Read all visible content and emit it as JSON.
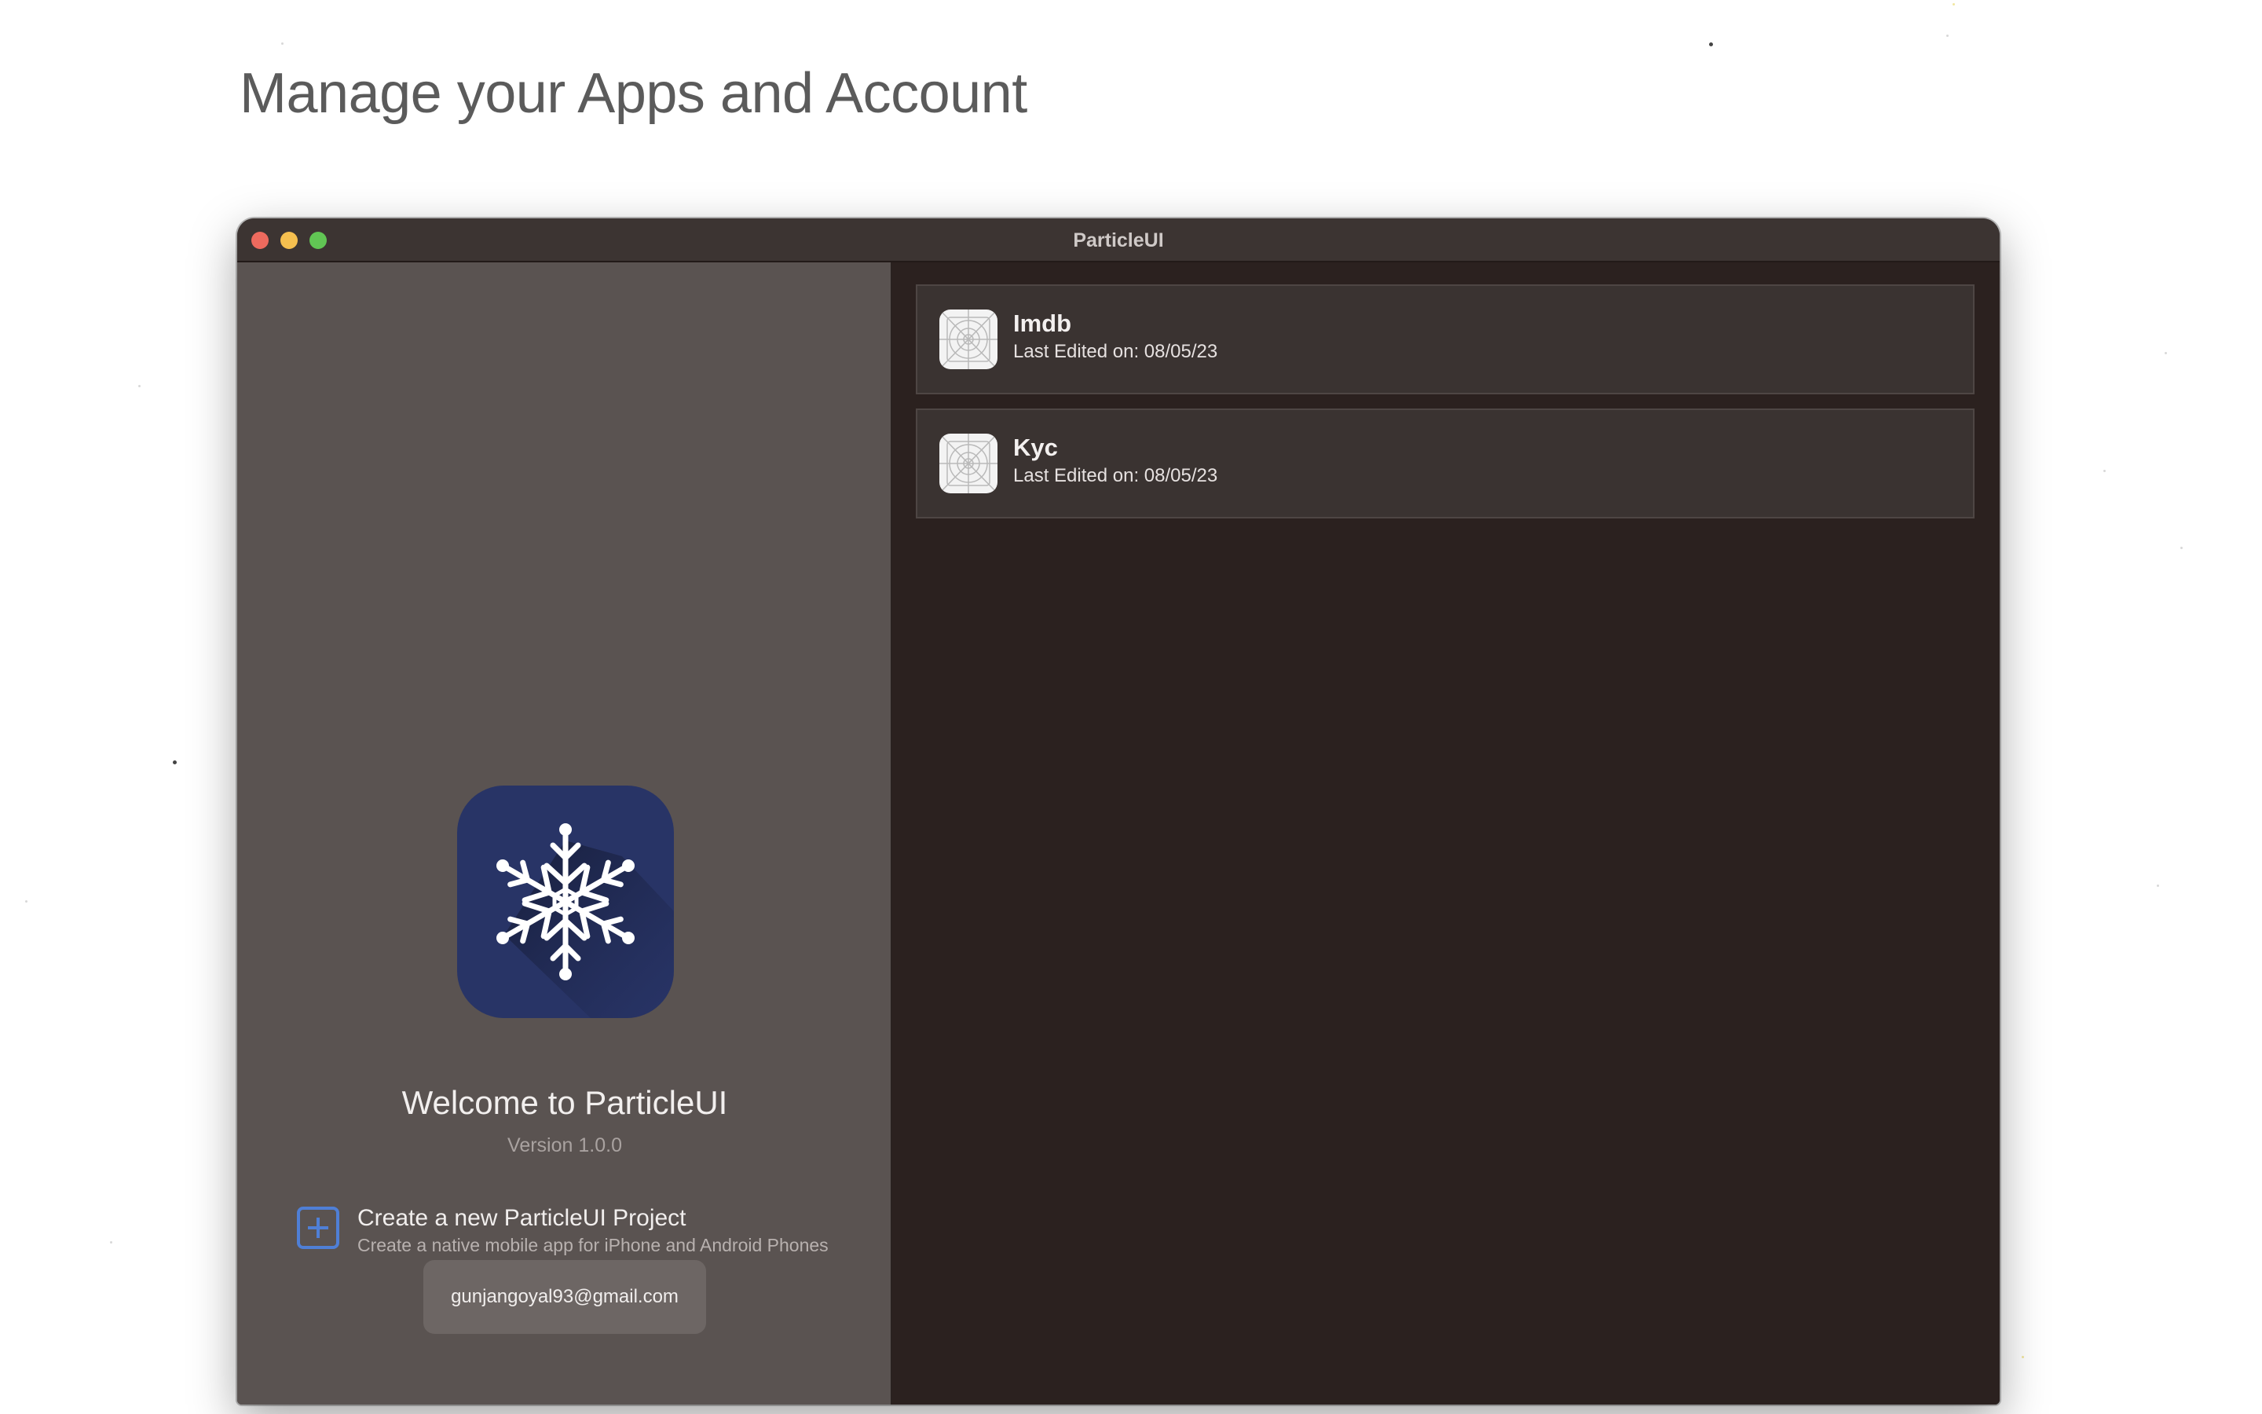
{
  "page": {
    "headline": "Manage your Apps and Account"
  },
  "window": {
    "title": "ParticleUI"
  },
  "sidebar": {
    "welcome_title": "Welcome to ParticleUI",
    "version_label": "Version 1.0.0",
    "create_project": {
      "title": "Create a new ParticleUI Project",
      "subtitle": "Create a native mobile app for iPhone and Android Phones"
    },
    "account_email": "gunjangoyal93@gmail.com"
  },
  "projects": [
    {
      "name": "Imdb",
      "last_edited": "Last Edited on: 08/05/23"
    },
    {
      "name": "Kyc",
      "last_edited": "Last Edited on: 08/05/23"
    }
  ],
  "colors": {
    "accent_blue": "#4f7fd6",
    "app_icon_bg": "#283466",
    "sidebar_bg": "#5a5351",
    "content_bg": "#2b211f"
  },
  "icons": {
    "app_logo": "snowflake-icon",
    "create": "plus-square-icon",
    "project_placeholder": "app-placeholder-icon"
  }
}
